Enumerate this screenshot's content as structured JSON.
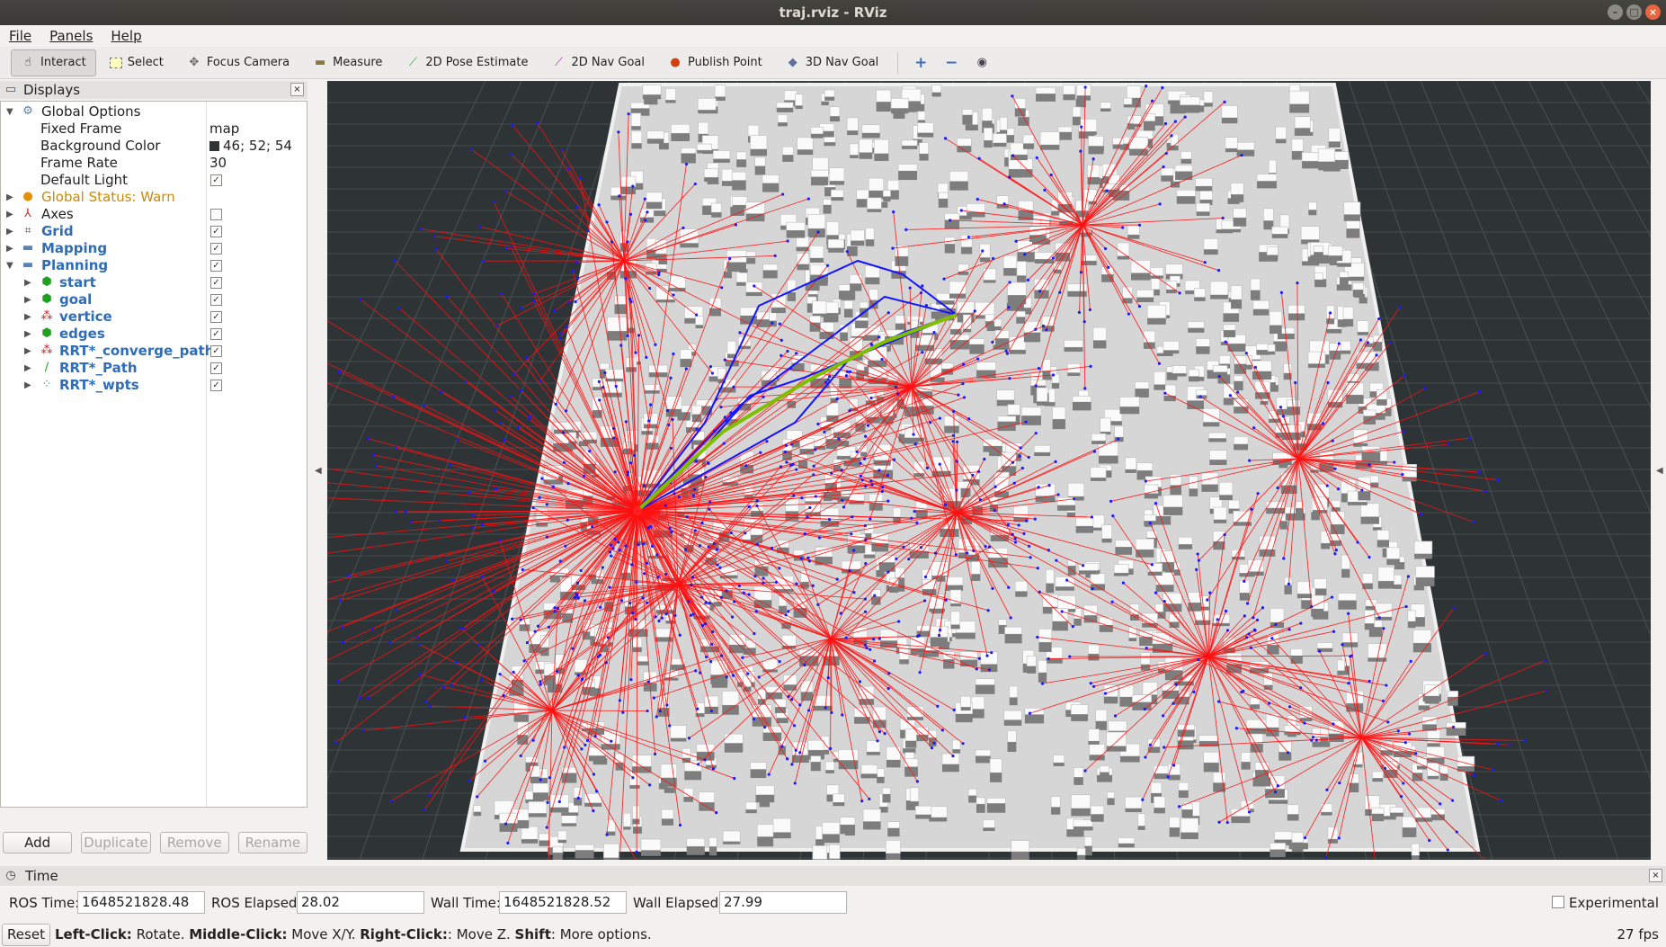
{
  "window": {
    "title": "traj.rviz - RViz"
  },
  "menu": [
    "File",
    "Panels",
    "Help"
  ],
  "toolbar": {
    "tools": [
      {
        "label": "Interact",
        "icon": "hand-icon"
      },
      {
        "label": "Select",
        "icon": "select-box-icon"
      },
      {
        "label": "Focus Camera",
        "icon": "focus-camera-icon"
      },
      {
        "label": "Measure",
        "icon": "ruler-icon"
      },
      {
        "label": "2D Pose Estimate",
        "icon": "pose-arrow-icon"
      },
      {
        "label": "2D Nav Goal",
        "icon": "nav-arrow-icon"
      },
      {
        "label": "Publish Point",
        "icon": "map-pin-icon"
      },
      {
        "label": "3D Nav Goal",
        "icon": "cube-icon"
      }
    ],
    "active": "Interact"
  },
  "displays": {
    "title": "Displays",
    "global_options": "Global Options",
    "fixed_frame_label": "Fixed Frame",
    "fixed_frame_value": "map",
    "bg_color_label": "Background Color",
    "bg_color_value": "46; 52; 54",
    "frame_rate_label": "Frame Rate",
    "frame_rate_value": "30",
    "default_light_label": "Default Light",
    "global_status": "Global Status: Warn",
    "axes": "Axes",
    "grid": "Grid",
    "mapping": "Mapping",
    "planning": "Planning",
    "start": "start",
    "goal": "goal",
    "vertice": "vertice",
    "edges": "edges",
    "converge": "RRT*_converge_paths",
    "path": "RRT*_Path",
    "wpts": "RRT*_wpts",
    "buttons": {
      "add": "Add",
      "duplicate": "Duplicate",
      "remove": "Remove",
      "rename": "Rename"
    }
  },
  "time": {
    "title": "Time",
    "ros_time_label": "ROS Time:",
    "ros_time": "1648521828.48",
    "ros_elapsed_label": "ROS Elapsed:",
    "ros_elapsed": "28.02",
    "wall_time_label": "Wall Time:",
    "wall_time": "1648521828.52",
    "wall_elapsed_label": "Wall Elapsed:",
    "wall_elapsed": "27.99",
    "experimental": "Experimental"
  },
  "status": {
    "reset": "Reset",
    "left_click": "Left-Click:",
    "left_text": " Rotate. ",
    "middle_click": "Middle-Click:",
    "middle_text": " Move X/Y. ",
    "right_click": "Right-Click:",
    "right_text": ": Move Z. ",
    "shift": "Shift",
    "shift_text": ": More options.",
    "fps": "27 fps"
  },
  "colors": {
    "viewport_bg": "#2e3436",
    "tree_edges": "#ff0000",
    "converge_paths": "#0000ff",
    "rrt_path": "#7fbf00"
  }
}
